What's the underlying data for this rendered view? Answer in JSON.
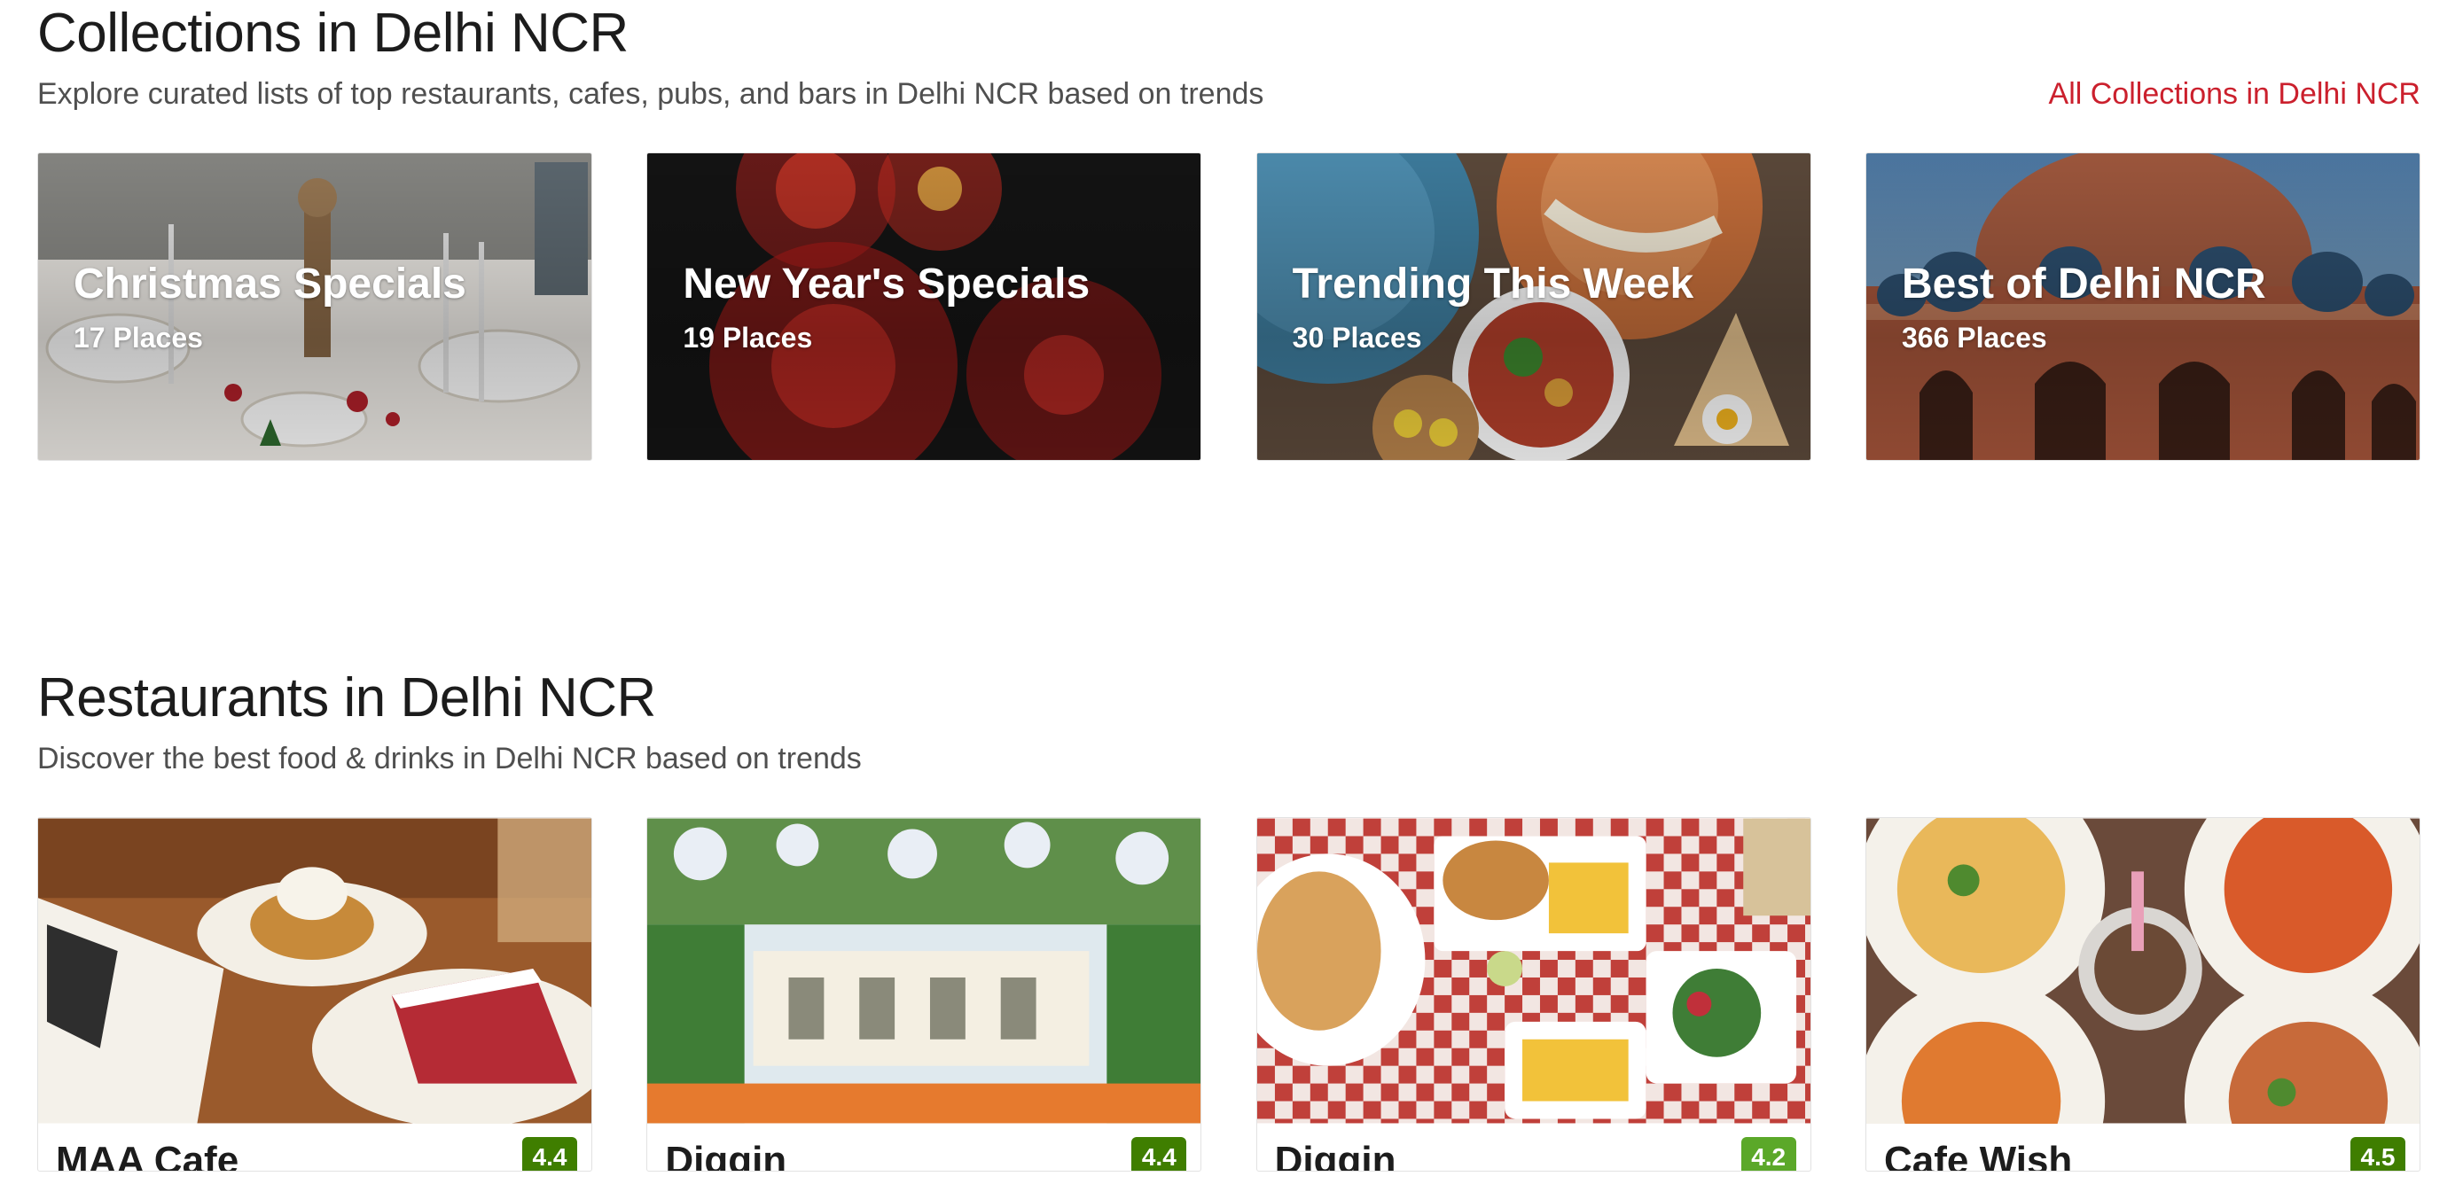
{
  "collections": {
    "title": "Collections in Delhi NCR",
    "subtitle": "Explore curated lists of top restaurants, cafes, pubs, and bars in Delhi NCR based on trends",
    "see_all": "All Collections in Delhi NCR",
    "items": [
      {
        "name": "Christmas Specials",
        "count": "17 Places"
      },
      {
        "name": "New Year's Specials",
        "count": "19 Places"
      },
      {
        "name": "Trending This Week",
        "count": "30 Places"
      },
      {
        "name": "Best of Delhi NCR",
        "count": "366 Places"
      }
    ]
  },
  "restaurants": {
    "title": "Restaurants in Delhi NCR",
    "subtitle": "Discover the best food & drinks in Delhi NCR based on trends",
    "items": [
      {
        "name": "MAA Cafe",
        "rating": "4.4"
      },
      {
        "name": "Diggin",
        "rating": "4.4"
      },
      {
        "name": "Diggin",
        "rating": "4.2"
      },
      {
        "name": "Cafe Wish",
        "rating": "4.5"
      }
    ]
  },
  "colors": {
    "accent": "#cb202d",
    "rating_dark_green": "#3f7e00",
    "rating_green": "#5ba829"
  }
}
